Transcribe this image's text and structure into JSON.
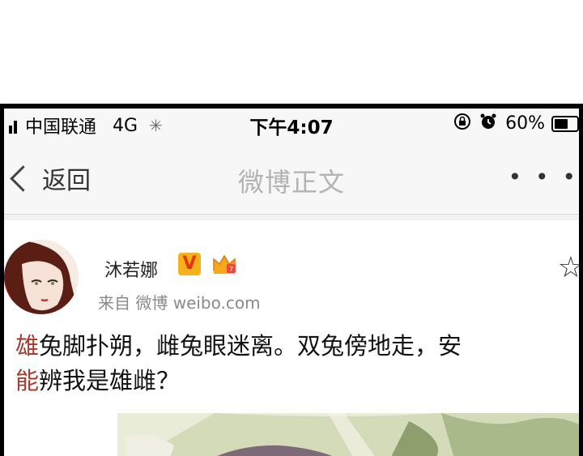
{
  "status_bar": {
    "carrier": "中国联通",
    "network": "4G",
    "time": "下午4:07",
    "battery": "60%",
    "battery_level": 0.6
  },
  "nav": {
    "back_label": "返回",
    "title": "微博正文"
  },
  "post": {
    "author": "沐若娜",
    "badge_v": "V",
    "source": "来自 微博 weibo.com",
    "line1_first": "雄",
    "line1_rest": "兔脚扑朔，雌兔眼迷离。双兔傍地走，安",
    "line2_first": "能",
    "line2_rest": "辨我是雄雌？"
  },
  "colors": {
    "highlight": "#a43c32",
    "nav_title": "#b3b3b3",
    "badge_gold": "#f5b11b"
  },
  "icons": [
    "spinner-icon",
    "rotation-lock-icon",
    "alarm-icon",
    "battery-icon",
    "chevron-left-icon",
    "more-icon",
    "star-icon",
    "crown-icon"
  ]
}
